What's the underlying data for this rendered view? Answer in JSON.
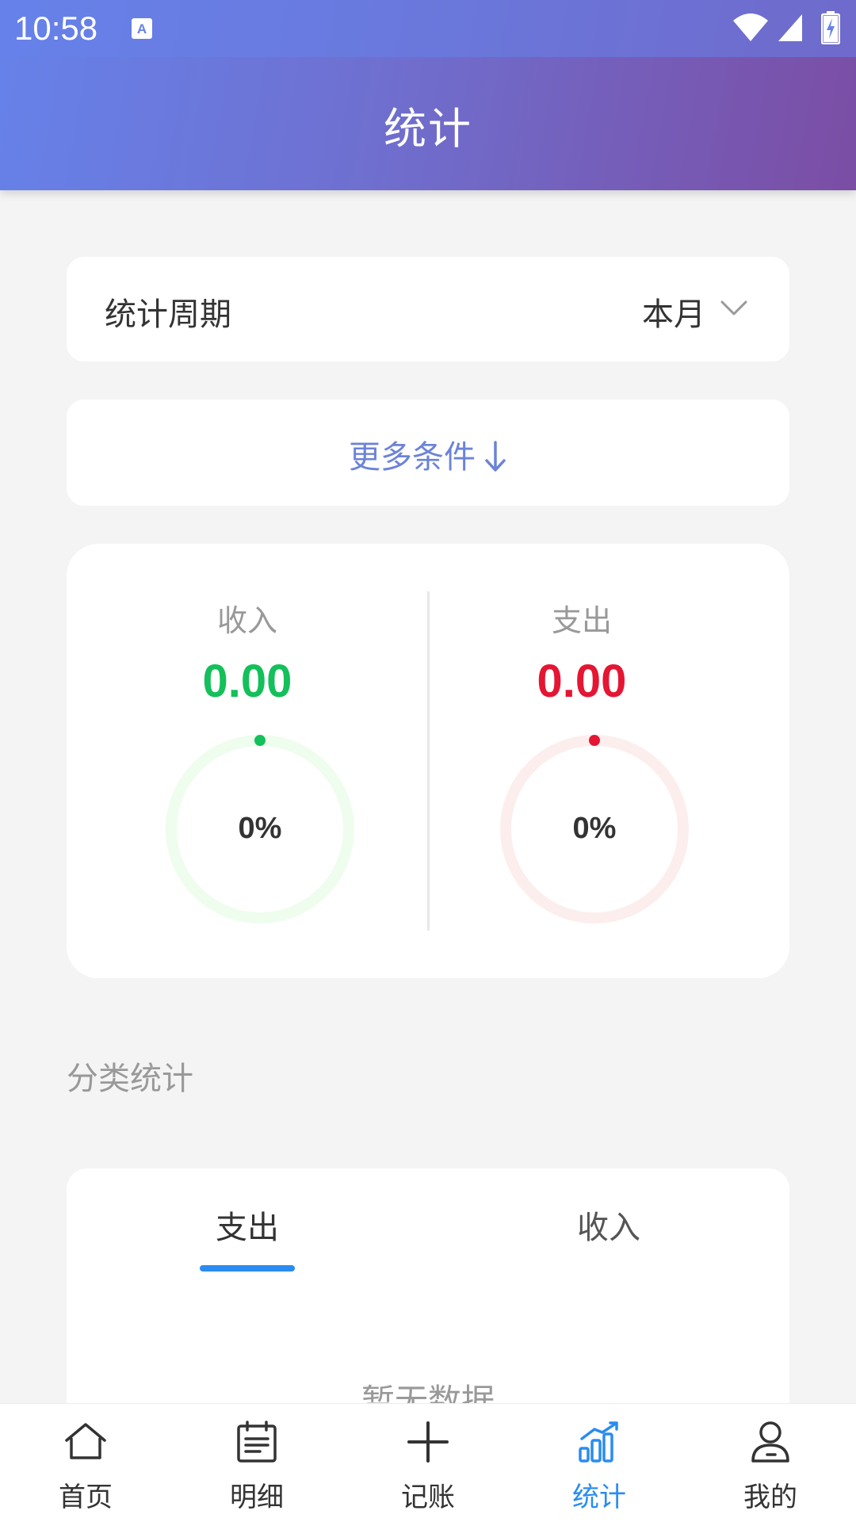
{
  "status_bar": {
    "time": "10:58",
    "icons": [
      "keyboard-a-icon",
      "wifi-icon",
      "signal-icon",
      "battery-charging-icon"
    ]
  },
  "header": {
    "title": "统计"
  },
  "period": {
    "label": "统计周期",
    "value": "本月",
    "icon": "chevron-down-icon"
  },
  "more_conditions": {
    "label": "更多条件",
    "icon": "arrow-down-icon"
  },
  "summary": {
    "income": {
      "label": "收入",
      "amount": "0.00",
      "percent_label": "0%",
      "percent": 0,
      "color": "#13c05a"
    },
    "expense": {
      "label": "支出",
      "amount": "0.00",
      "percent_label": "0%",
      "percent": 0,
      "color": "#e41633"
    }
  },
  "category_section": {
    "title": "分类统计"
  },
  "category_tabs": {
    "tabs": [
      {
        "label": "支出",
        "active": true
      },
      {
        "label": "收入",
        "active": false
      }
    ],
    "empty_text": "暂无数据"
  },
  "bottom_nav": {
    "items": [
      {
        "label": "首页",
        "icon": "home-icon",
        "active": false
      },
      {
        "label": "明细",
        "icon": "list-doc-icon",
        "active": false
      },
      {
        "label": "记账",
        "icon": "plus-icon",
        "active": false
      },
      {
        "label": "统计",
        "icon": "bar-chart-icon",
        "active": true
      },
      {
        "label": "我的",
        "icon": "user-icon",
        "active": false
      }
    ]
  },
  "colors": {
    "accent": "#2a8cf0",
    "header_start": "#6682ea",
    "header_end": "#7b4da4",
    "link": "#6b83d8"
  }
}
